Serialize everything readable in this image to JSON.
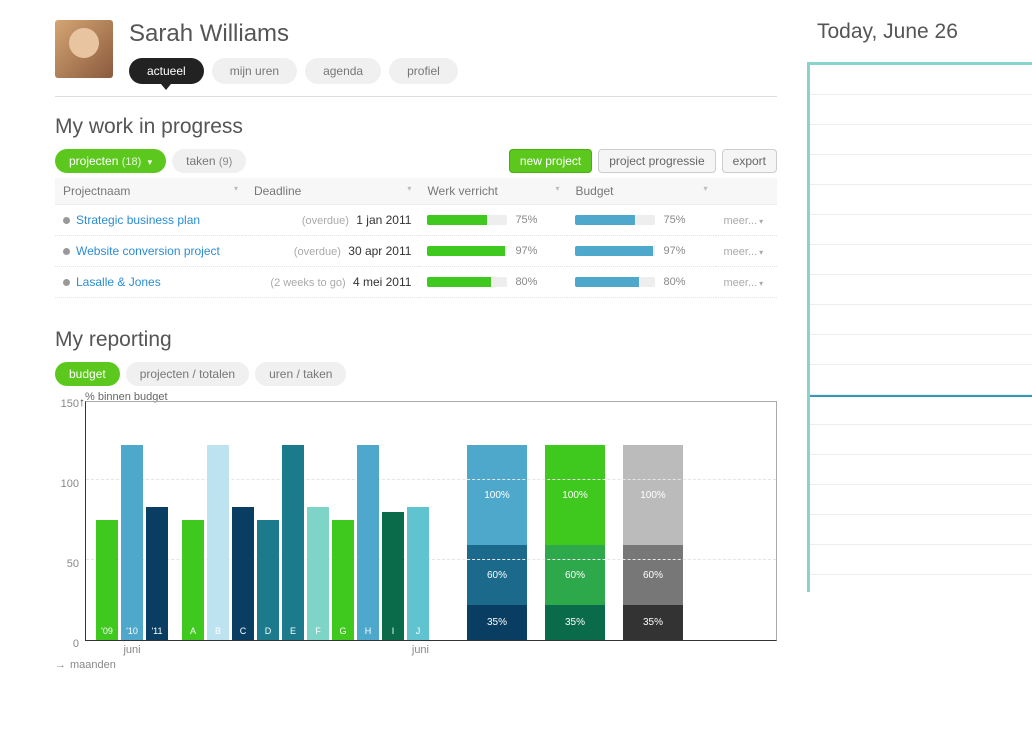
{
  "user": {
    "name": "Sarah Williams"
  },
  "nav_tabs": [
    {
      "label": "actueel",
      "active": true
    },
    {
      "label": "mijn uren",
      "active": false
    },
    {
      "label": "agenda",
      "active": false
    },
    {
      "label": "profiel",
      "active": false
    }
  ],
  "work_section": {
    "title": "My work in progress",
    "pills": [
      {
        "label": "projecten",
        "count": "(18)",
        "active": true,
        "dropdown": true
      },
      {
        "label": "taken",
        "count": "(9)",
        "active": false
      }
    ],
    "actions": [
      {
        "label": "new project",
        "style": "green"
      },
      {
        "label": "project progressie",
        "style": ""
      },
      {
        "label": "export",
        "style": ""
      }
    ],
    "columns": [
      {
        "label": "Projectnaam"
      },
      {
        "label": "Deadline"
      },
      {
        "label": "Werk verricht"
      },
      {
        "label": "Budget"
      },
      {
        "label": ""
      }
    ],
    "rows": [
      {
        "name": "Strategic business plan",
        "deadline_note": "(overdue)",
        "deadline": "1 jan 2011",
        "work_pct": 75,
        "budget_pct": 75,
        "more": "meer..."
      },
      {
        "name": "Website conversion project",
        "deadline_note": "(overdue)",
        "deadline": "30 apr 2011",
        "work_pct": 97,
        "budget_pct": 97,
        "more": "meer..."
      },
      {
        "name": "Lasalle & Jones",
        "deadline_note": "(2 weeks to go)",
        "deadline": "4 mei 2011",
        "work_pct": 80,
        "budget_pct": 80,
        "more": "meer..."
      }
    ]
  },
  "reporting_section": {
    "title": "My reporting",
    "pills": [
      {
        "label": "budget",
        "active": true
      },
      {
        "label": "projecten / totalen",
        "active": false
      },
      {
        "label": "uren / taken",
        "active": false
      }
    ],
    "y_axis_label": "% binnen budget",
    "y_ticks": [
      "0",
      "50",
      "100",
      "150"
    ],
    "x_axis_label": "maanden",
    "group1_label": "juni",
    "group2_label": "juni"
  },
  "chart_data": {
    "type": "bar",
    "title": "% binnen budget",
    "ylabel": "% binnen budget",
    "xlabel": "maanden",
    "ylim": [
      0,
      150
    ],
    "grouped_bars": [
      {
        "label": "'09",
        "value": 75,
        "color": "#3fc81e"
      },
      {
        "label": "'10",
        "value": 122,
        "color": "#4da8cc"
      },
      {
        "label": "'11",
        "value": 83,
        "color": "#0a3d62"
      },
      {
        "label": "A",
        "value": 75,
        "color": "#3fc81e"
      },
      {
        "label": "B",
        "value": 122,
        "color": "#bde3f0"
      },
      {
        "label": "C",
        "value": 83,
        "color": "#0a3d62"
      },
      {
        "label": "D",
        "value": 75,
        "color": "#1b7a8c"
      },
      {
        "label": "E",
        "value": 122,
        "color": "#1b7a8c"
      },
      {
        "label": "F",
        "value": 83,
        "color": "#7fd4c8"
      },
      {
        "label": "G",
        "value": 75,
        "color": "#3fc81e"
      },
      {
        "label": "H",
        "value": 122,
        "color": "#4da8cc"
      },
      {
        "label": "I",
        "value": 80,
        "color": "#0a6b4a"
      },
      {
        "label": "J",
        "value": 83,
        "color": "#5fc4d0"
      }
    ],
    "stacked_bars": [
      {
        "segments": [
          {
            "value": 35,
            "label": "35%",
            "color": "#0a3d62"
          },
          {
            "value": 60,
            "label": "60%",
            "color": "#1b6a8c"
          },
          {
            "value": 100,
            "label": "100%",
            "color": "#4da8cc"
          }
        ]
      },
      {
        "segments": [
          {
            "value": 35,
            "label": "35%",
            "color": "#0a6b4a"
          },
          {
            "value": 60,
            "label": "60%",
            "color": "#2da84a"
          },
          {
            "value": 100,
            "label": "100%",
            "color": "#3fc81e"
          }
        ]
      },
      {
        "segments": [
          {
            "value": 35,
            "label": "35%",
            "color": "#333333"
          },
          {
            "value": 60,
            "label": "60%",
            "color": "#777777"
          },
          {
            "value": 100,
            "label": "100%",
            "color": "#bbbbbb"
          }
        ]
      }
    ]
  },
  "sidebar": {
    "today_title": "Today, June 26"
  }
}
